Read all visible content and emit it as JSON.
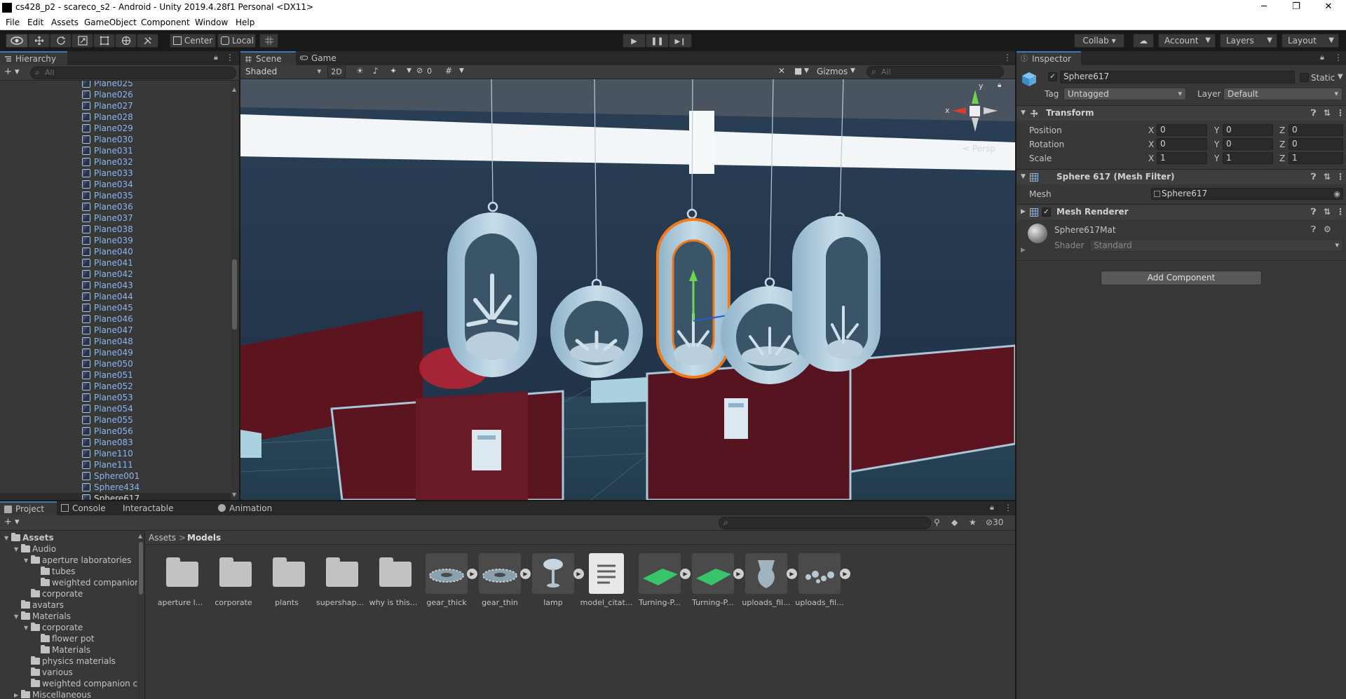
{
  "window": {
    "title": "cs428_p2 - scareco_s2 - Android - Unity 2019.4.28f1 Personal <DX11>",
    "minimize": "─",
    "maximize": "❐",
    "close": "✕"
  },
  "menu": [
    "File",
    "Edit",
    "Assets",
    "GameObject",
    "Component",
    "Window",
    "Help"
  ],
  "toolbar": {
    "pivot_label": "Center",
    "space_label": "Local",
    "collab_label": "Collab ▾",
    "account_label": "Account",
    "layers_label": "Layers",
    "layout_label": "Layout"
  },
  "hierarchy": {
    "tab": "Hierarchy",
    "search_placeholder": "All",
    "add_label": "+ ▾",
    "items": [
      "Plane025",
      "Plane026",
      "Plane027",
      "Plane028",
      "Plane029",
      "Plane030",
      "Plane031",
      "Plane032",
      "Plane033",
      "Plane034",
      "Plane035",
      "Plane036",
      "Plane037",
      "Plane038",
      "Plane039",
      "Plane040",
      "Plane041",
      "Plane042",
      "Plane043",
      "Plane044",
      "Plane045",
      "Plane046",
      "Plane047",
      "Plane048",
      "Plane049",
      "Plane050",
      "Plane051",
      "Plane052",
      "Plane053",
      "Plane054",
      "Plane055",
      "Plane056",
      "Plane083",
      "Plane110",
      "Plane111",
      "Sphere001",
      "Sphere434",
      "Sphere617"
    ],
    "selected": "Sphere617"
  },
  "scene": {
    "tab_scene": "Scene",
    "tab_game": "Game",
    "shading": "Shaded",
    "mode_2d": "2D",
    "hidden_count": "0",
    "gizmos": "Gizmos",
    "search_placeholder": "All",
    "persp_label": "Persp",
    "axis_y": "y",
    "axis_x": "x"
  },
  "inspector": {
    "tab": "Inspector",
    "object_name": "Sphere617",
    "static_label": "Static",
    "tag_label": "Tag",
    "tag_value": "Untagged",
    "layer_label": "Layer",
    "layer_value": "Default",
    "transform": {
      "header": "Transform",
      "position_label": "Position",
      "rotation_label": "Rotation",
      "scale_label": "Scale",
      "x": "X",
      "y": "Y",
      "z": "Z",
      "position": [
        "0",
        "0",
        "0"
      ],
      "rotation": [
        "0",
        "0",
        "0"
      ],
      "scale": [
        "1",
        "1",
        "1"
      ]
    },
    "mesh_filter": {
      "header": "Sphere 617 (Mesh Filter)",
      "mesh_label": "Mesh",
      "mesh_value": "Sphere617"
    },
    "mesh_renderer": {
      "header": "Mesh Renderer"
    },
    "material": {
      "name": "Sphere617Mat",
      "shader_label": "Shader",
      "shader_value": "Standard"
    },
    "add_component": "Add Component"
  },
  "bottom": {
    "tabs": [
      "Project",
      "Console",
      "Interactable Creator",
      "Animation"
    ],
    "hidden_count": "30",
    "breadcrumb_root": "Assets",
    "breadcrumb_sep": ">",
    "breadcrumb_current": "Models",
    "tree": [
      {
        "label": "Assets",
        "depth": 0,
        "arrow": "▼",
        "bold": true
      },
      {
        "label": "Audio",
        "depth": 1,
        "arrow": "▼"
      },
      {
        "label": "aperture laboratories",
        "depth": 2,
        "arrow": "▼"
      },
      {
        "label": "tubes",
        "depth": 3,
        "arrow": ""
      },
      {
        "label": "weighted companion",
        "depth": 3,
        "arrow": ""
      },
      {
        "label": "corporate",
        "depth": 2,
        "arrow": ""
      },
      {
        "label": "avatars",
        "depth": 1,
        "arrow": ""
      },
      {
        "label": "Materials",
        "depth": 1,
        "arrow": "▼"
      },
      {
        "label": "corporate",
        "depth": 2,
        "arrow": "▼"
      },
      {
        "label": "flower pot",
        "depth": 3,
        "arrow": ""
      },
      {
        "label": "Materials",
        "depth": 3,
        "arrow": ""
      },
      {
        "label": "physics materials",
        "depth": 2,
        "arrow": ""
      },
      {
        "label": "various",
        "depth": 2,
        "arrow": ""
      },
      {
        "label": "weighted companion cu",
        "depth": 2,
        "arrow": ""
      },
      {
        "label": "Miscellaneous",
        "depth": 1,
        "arrow": "▶"
      }
    ],
    "assets": [
      {
        "label": "aperture l...",
        "kind": "folder"
      },
      {
        "label": "corporate",
        "kind": "folder"
      },
      {
        "label": "plants",
        "kind": "folder"
      },
      {
        "label": "supershap...",
        "kind": "folder"
      },
      {
        "label": "why is this...",
        "kind": "folder"
      },
      {
        "label": "gear_thick",
        "kind": "gear"
      },
      {
        "label": "gear_thin",
        "kind": "gear"
      },
      {
        "label": "lamp",
        "kind": "lamp"
      },
      {
        "label": "model_citat...",
        "kind": "text"
      },
      {
        "label": "Turning-P...",
        "kind": "plane"
      },
      {
        "label": "Turning-P...",
        "kind": "plane"
      },
      {
        "label": "uploads_fil...",
        "kind": "vase"
      },
      {
        "label": "uploads_fil...",
        "kind": "rocks"
      }
    ]
  },
  "colors": {
    "accent": "#3a79bb",
    "panel": "#383838",
    "selection_outline": "#f07a1a"
  }
}
